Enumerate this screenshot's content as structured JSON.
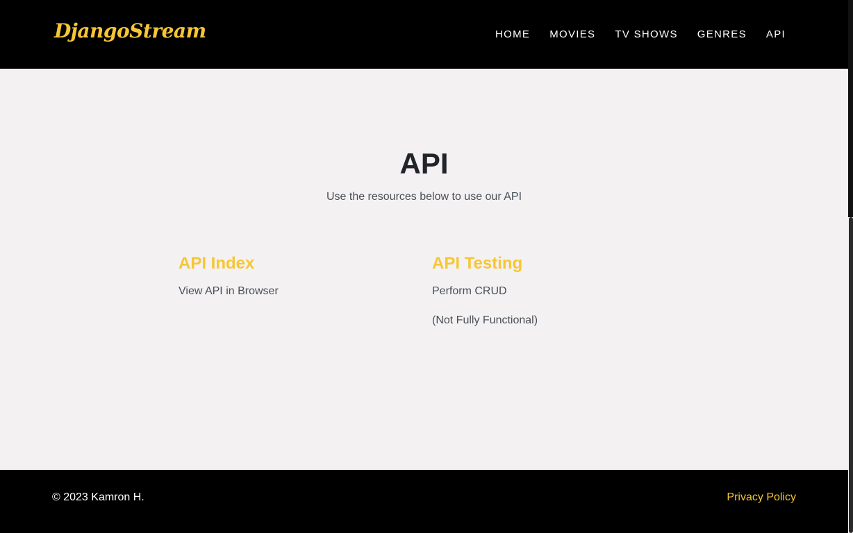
{
  "header": {
    "brand": "DjangoStream",
    "nav": [
      {
        "label": "HOME"
      },
      {
        "label": "MOVIES"
      },
      {
        "label": "TV SHOWS"
      },
      {
        "label": "GENRES"
      },
      {
        "label": "API"
      }
    ]
  },
  "main": {
    "title": "API",
    "subtitle": "Use the resources below to use our API",
    "cards": [
      {
        "title": "API Index",
        "lines": [
          "View API in Browser"
        ]
      },
      {
        "title": "API Testing",
        "lines": [
          "Perform CRUD",
          "(Not Fully Functional)"
        ]
      }
    ]
  },
  "footer": {
    "copyright": "© 2023 Kamron H.",
    "privacy_label": "Privacy Policy"
  },
  "colors": {
    "accent": "#f7c634",
    "header_bg": "#000000",
    "page_bg": "#f3f1f2",
    "heading": "#212529",
    "body_text": "#495057"
  }
}
